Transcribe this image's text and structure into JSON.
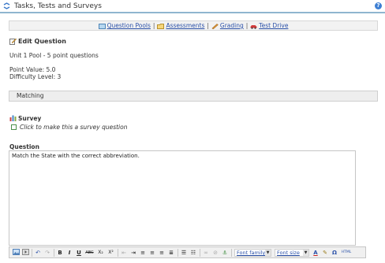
{
  "header": {
    "title": "Tasks, Tests and Surveys",
    "help_icon": "?"
  },
  "nav": {
    "question_pools": "Question Pools",
    "assessments": "Assessments",
    "grading": "Grading",
    "test_drive": "Test Drive",
    "separator": "|"
  },
  "edit": {
    "heading": "Edit Question",
    "pool": "Unit 1 Pool - 5 point questions",
    "point_value": "Point Value: 5.0",
    "difficulty": "Difficulty Level: 3"
  },
  "question_type": "Matching",
  "survey": {
    "label": "Survey",
    "checkbox_text": "Click to make this a survey question",
    "checked": false
  },
  "question": {
    "label": "Question",
    "body": "Match the State with the correct abbreviation."
  },
  "toolbar": {
    "bold": "B",
    "italic": "I",
    "underline": "U",
    "strikethrough": "ABC",
    "subscript": "X₂",
    "superscript": "X²",
    "font_family": "Font family",
    "font_size": "Font size",
    "text_color": "A",
    "omega": "Ω",
    "html": "HTML"
  },
  "colors": {
    "link": "#2a50a8",
    "header_rule": "#8fb6cf",
    "bar_bg": "#eeeeee"
  }
}
